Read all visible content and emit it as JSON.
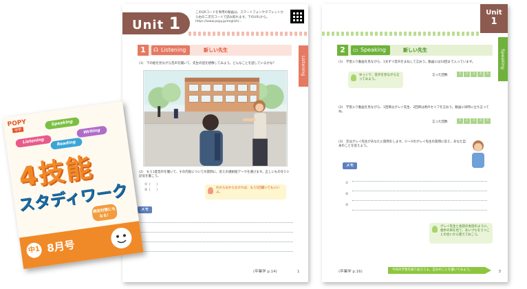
{
  "left_page": {
    "unit_word": "Unit",
    "unit_number": "1",
    "header_note": "このQRコードを専用の動画は、スマートフォンやタブレットから右の二次元コードで読み取れます。下のURLから。 https://www.popy.jp/english/...",
    "section_number": "1",
    "section_name": "Listening",
    "section_title": "新しい先生",
    "side_tab": "Listening",
    "q1": "(1)　下の絵を見ながら音声を聞いて、先生の話を想像してみよう。どんなことを話しているかな？",
    "q2": "(2)　もう1度音声を聞いて、その内容についての質問に、答えの選択肢ア〜ウを選びます。正しいものを1つ記号を書こう。",
    "answer_1": "①（　　）",
    "answer_2": "②（　　）",
    "hint": "わから分からなければ、もう1回聞いてもいいよ。",
    "memo_label": "メモ",
    "footer_code": "(卒業学 p.14)",
    "page_number": "1"
  },
  "right_page": {
    "unit_word": "Unit",
    "unit_number": "1",
    "section_number": "2",
    "section_name": "Speaking",
    "section_title": "新しい先生",
    "side_tab": "Speaking",
    "q1": "(1)　学習入り動画を見ながら、1文ずつ音声をまねして言おう。動画には10回まで入っています。",
    "q2": "(2)　学習入り動画を見ながら、1回目はグレイ先生、2回目は君のセリフを言おう。動画に同時に立ち言ってね。",
    "q3": "(3)　次はグレイ先生があなたに質問をします。①〜③のグレイ先生の質問に答え、あなた自身のことを答えよう。",
    "spoken_label": "言った回数",
    "count_boxes": [
      "1",
      "2",
      "3",
      "4",
      "5"
    ],
    "hint_1": "ゆっくり、音声を見ながら言ってみよう。",
    "hint_2": "グレイ先生と会話の会話のように、相手の目を見て、あいづちをうつことの合いから使えておこう。",
    "memo_label": "メモ",
    "answer_1": "①",
    "answer_2": "②",
    "answer_3": "③",
    "footer_band": "今日の学習を振り返ろうよ。自分のことを書いてみよう。",
    "footer_code": "(卒業学 p.16)",
    "page_number": "3"
  },
  "cover": {
    "brand": "POPY",
    "tag": "中学",
    "cloud_speaking": "Speaking",
    "cloud_listening": "Listening",
    "cloud_writing": "Writing",
    "cloud_reading": "Reading",
    "title_main": "4技能",
    "title_sub": "スタディワーク",
    "badge": "検定対策にもなる！",
    "grade": "中1",
    "month": "8月号"
  },
  "colors": {
    "listening_accent": "#e57a63",
    "speaking_accent": "#6fb23b",
    "unit_tab": "#8c5a4e",
    "cover_orange": "#f08a28",
    "cover_blue": "#1b6ca8"
  }
}
